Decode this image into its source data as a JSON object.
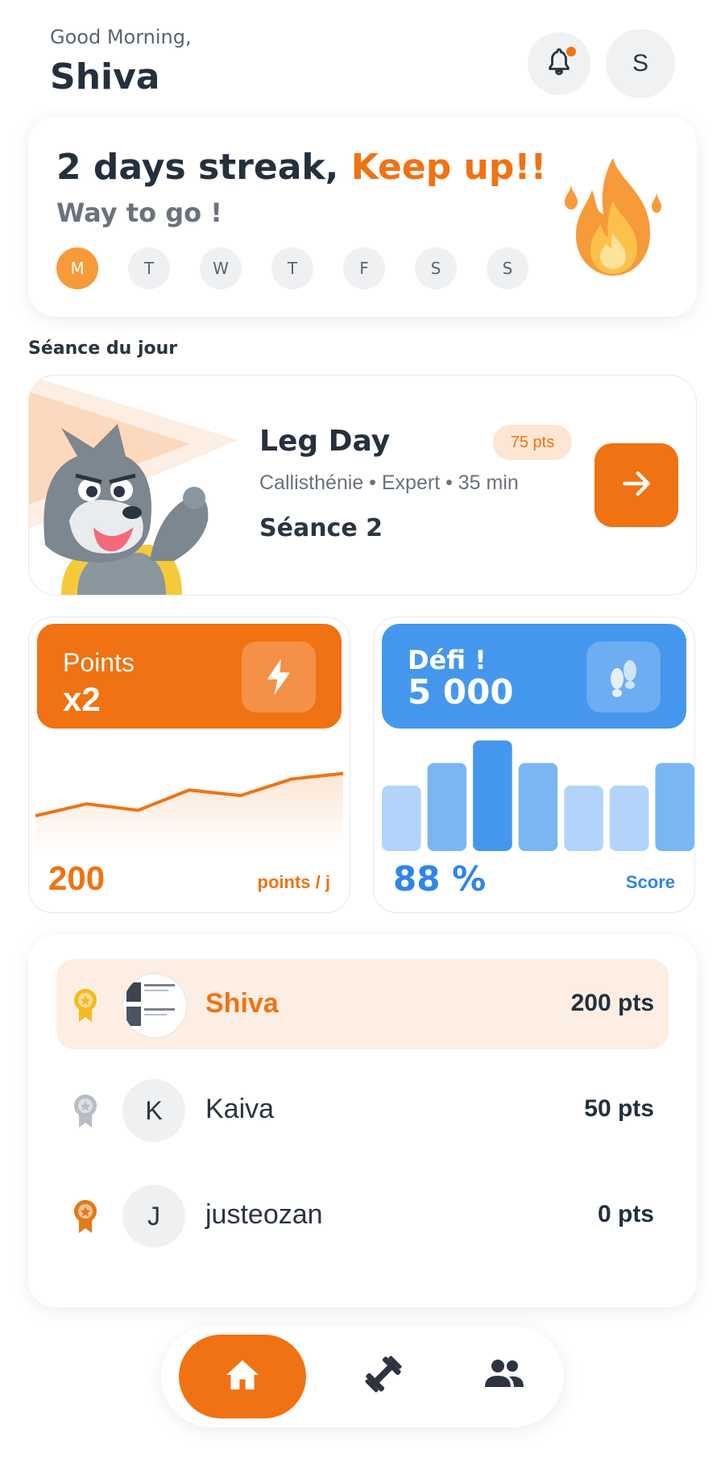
{
  "header": {
    "greeting": "Good Morning,",
    "name": "Shiva",
    "avatar_initial": "S"
  },
  "streak": {
    "title_main": "2 days streak, ",
    "title_accent": "Keep up!!",
    "subtitle": "Way to go !",
    "days": [
      "M",
      "T",
      "W",
      "T",
      "F",
      "S",
      "S"
    ],
    "active_index": 0,
    "icon": "fire-icon"
  },
  "section_label": "Séance du jour",
  "workout": {
    "title": "Leg Day",
    "points_badge": "75 pts",
    "meta": "Callisthénie • Expert • 35 min",
    "session": "Séance 2",
    "mascot": "wolf-mascot"
  },
  "points_card": {
    "label": "Points",
    "multiplier": "x2",
    "icon": "lightning-icon",
    "value": "200",
    "unit": "points / j",
    "trend": [
      12,
      25,
      18,
      40,
      34,
      52,
      58
    ],
    "color": "#f07213"
  },
  "challenge_card": {
    "label": "Défi !",
    "target": "5 000",
    "icon": "footsteps-icon",
    "value": "88 %",
    "unit": "Score",
    "bars": [
      0.58,
      0.78,
      0.98,
      0.78,
      0.58,
      0.58,
      0.78
    ],
    "color": "#4597ee"
  },
  "leaderboard": [
    {
      "name": "Shiva",
      "points": "200 pts",
      "initial": "",
      "medal": "gold",
      "is_me": true
    },
    {
      "name": "Kaiva",
      "points": "50 pts",
      "initial": "K",
      "medal": "silver",
      "is_me": false
    },
    {
      "name": "justeozan",
      "points": "0 pts",
      "initial": "J",
      "medal": "bronze",
      "is_me": false
    }
  ],
  "nav": {
    "items": [
      "home-icon",
      "dumbbell-icon",
      "group-icon"
    ],
    "active": 0
  }
}
